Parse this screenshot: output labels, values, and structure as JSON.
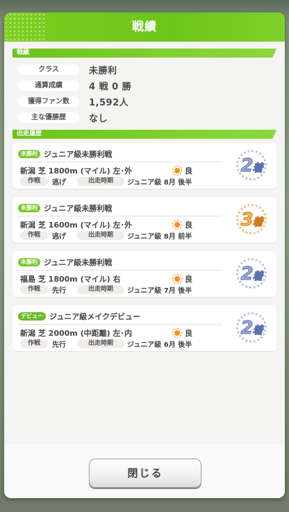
{
  "title": "戦績",
  "stats_section": {
    "label": "戦績",
    "rows": [
      {
        "label": "クラス",
        "value": "未勝利"
      },
      {
        "label": "通算成績",
        "value": "4 戦 0 勝"
      },
      {
        "label": "獲得ファン数",
        "value": "1,592人"
      },
      {
        "label": "主な優勝歴",
        "value": "なし"
      }
    ]
  },
  "history_section": {
    "label": "出走履歴",
    "races": [
      {
        "tag": "未勝利",
        "name": "ジュニア級未勝利戦",
        "course": "新潟 芝 1800m (マイル) 左･外",
        "weather": "良",
        "strategy_label": "作戦",
        "strategy": "逃げ",
        "timing_label": "出走時期",
        "timing": "ジュニア級 8月 後半",
        "rank_num": "2",
        "rank_suffix": "着",
        "rank_color": "blue"
      },
      {
        "tag": "未勝利",
        "name": "ジュニア級未勝利戦",
        "course": "新潟 芝 1600m (マイル) 左･外",
        "weather": "良",
        "strategy_label": "作戦",
        "strategy": "逃げ",
        "timing_label": "出走時期",
        "timing": "ジュニア級 8月 前半",
        "rank_num": "3",
        "rank_suffix": "着",
        "rank_color": "gold"
      },
      {
        "tag": "未勝利",
        "name": "ジュニア級未勝利戦",
        "course": "福島 芝 1800m (マイル) 右",
        "weather": "良",
        "strategy_label": "作戦",
        "strategy": "先行",
        "timing_label": "出走時期",
        "timing": "ジュニア級 7月 後半",
        "rank_num": "2",
        "rank_suffix": "着",
        "rank_color": "blue"
      },
      {
        "tag": "デビュー",
        "name": "ジュニア級メイクデビュー",
        "course": "新潟 芝 2000m (中距離) 左･内",
        "weather": "良",
        "strategy_label": "作戦",
        "strategy": "先行",
        "timing_label": "出走時期",
        "timing": "ジュニア級 6月 後半",
        "rank_num": "2",
        "rank_suffix": "着",
        "rank_color": "blue"
      }
    ]
  },
  "close_button": "閉じる",
  "colors": {
    "accent": "#6cc51c",
    "rank_blue": "#9aa8d6",
    "rank_gold": "#f7b65a"
  }
}
